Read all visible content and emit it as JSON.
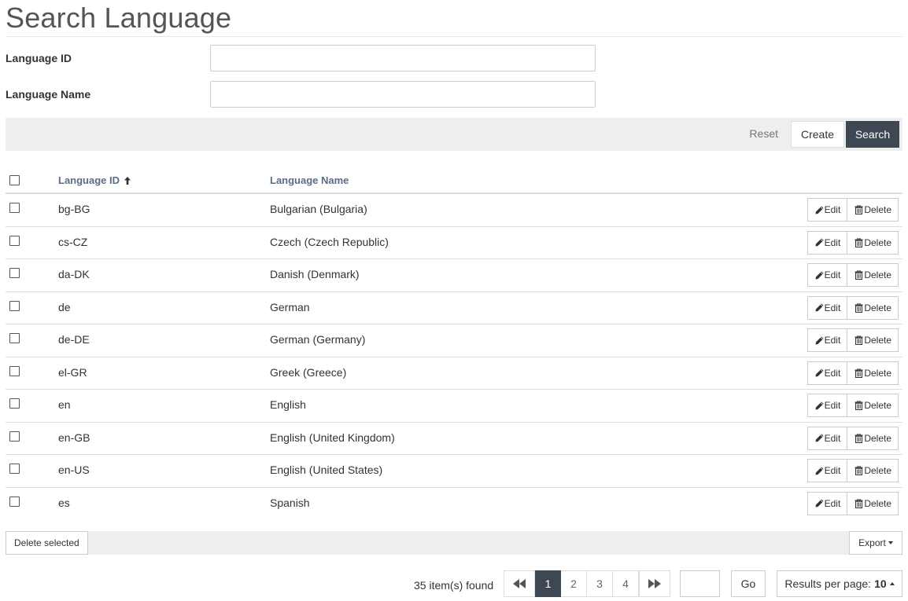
{
  "page": {
    "title": "Search Language"
  },
  "form": {
    "language_id_label": "Language ID",
    "language_id_value": "",
    "language_name_label": "Language Name",
    "language_name_value": ""
  },
  "toolbar": {
    "reset_label": "Reset",
    "create_label": "Create",
    "search_label": "Search"
  },
  "table": {
    "columns": [
      {
        "label": "Language ID",
        "sort": "ascending",
        "sort_icon": "arrow-up-icon"
      },
      {
        "label": "Language Name"
      }
    ],
    "row_actions": {
      "edit_label": "Edit",
      "edit_icon": "pencil-icon",
      "delete_label": "Delete",
      "delete_icon": "trash-icon"
    },
    "rows": [
      {
        "id": "bg-BG",
        "name": "Bulgarian (Bulgaria)",
        "checked": false
      },
      {
        "id": "cs-CZ",
        "name": "Czech (Czech Republic)",
        "checked": false
      },
      {
        "id": "da-DK",
        "name": "Danish (Denmark)",
        "checked": false
      },
      {
        "id": "de",
        "name": "German",
        "checked": false
      },
      {
        "id": "de-DE",
        "name": "German (Germany)",
        "checked": false
      },
      {
        "id": "el-GR",
        "name": "Greek (Greece)",
        "checked": false
      },
      {
        "id": "en",
        "name": "English",
        "checked": false
      },
      {
        "id": "en-GB",
        "name": "English (United Kingdom)",
        "checked": false
      },
      {
        "id": "en-US",
        "name": "English (United States)",
        "checked": false
      },
      {
        "id": "es",
        "name": "Spanish",
        "checked": false
      }
    ]
  },
  "footer": {
    "delete_selected_label": "Delete selected",
    "export_label": "Export"
  },
  "pagination": {
    "items_found": "35 item(s) found",
    "first_icon": "double-chevron-left-icon",
    "last_icon": "double-chevron-right-icon",
    "pages": [
      "1",
      "2",
      "3",
      "4"
    ],
    "current_page": "1",
    "goto_value": "",
    "go_label": "Go",
    "results_per_page_label": "Results per page:",
    "results_per_page_value": "10"
  },
  "colors": {
    "accent": "#3d4853",
    "header_link": "#5a6e85",
    "toolbar_bg": "#eeeeee"
  }
}
